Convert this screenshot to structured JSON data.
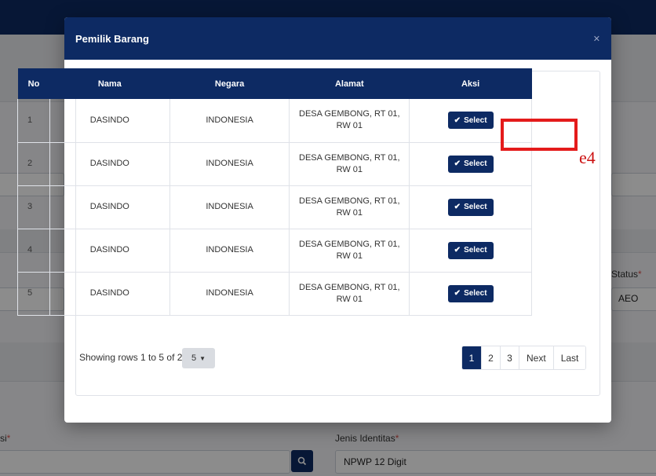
{
  "background": {
    "status_label": "Status",
    "status_value": "AEO",
    "left_label": "si",
    "jenis_identitas_label": "Jenis Identitas",
    "jenis_identitas_value": "NPWP 12 Digit"
  },
  "modal": {
    "title": "Pemilik Barang",
    "columns": [
      "No",
      "Nama",
      "Negara",
      "Alamat",
      "Aksi"
    ],
    "rows": [
      {
        "no": "1",
        "nama": "DASINDO",
        "negara": "INDONESIA",
        "alamat": "DESA GEMBONG, RT 01, RW 01",
        "action": "Select"
      },
      {
        "no": "2",
        "nama": "DASINDO",
        "negara": "INDONESIA",
        "alamat": "DESA GEMBONG, RT 01, RW 01",
        "action": "Select"
      },
      {
        "no": "3",
        "nama": "DASINDO",
        "negara": "INDONESIA",
        "alamat": "DESA GEMBONG, RT 01, RW 01",
        "action": "Select"
      },
      {
        "no": "4",
        "nama": "DASINDO",
        "negara": "INDONESIA",
        "alamat": "DESA GEMBONG, RT 01, RW 01",
        "action": "Select"
      },
      {
        "no": "5",
        "nama": "DASINDO",
        "negara": "INDONESIA",
        "alamat": "DESA GEMBONG, RT 01, RW 01",
        "action": "Select"
      }
    ],
    "rows_info": "Showing rows 1 to 5 of 26",
    "page_size": "5",
    "pagination": [
      "1",
      "2",
      "3",
      "Next",
      "Last"
    ],
    "active_page": "1"
  },
  "annotation": {
    "label": "e4",
    "color": "#e41b1b"
  },
  "colors": {
    "primary": "#0d2a63",
    "required": "#d9534f"
  }
}
